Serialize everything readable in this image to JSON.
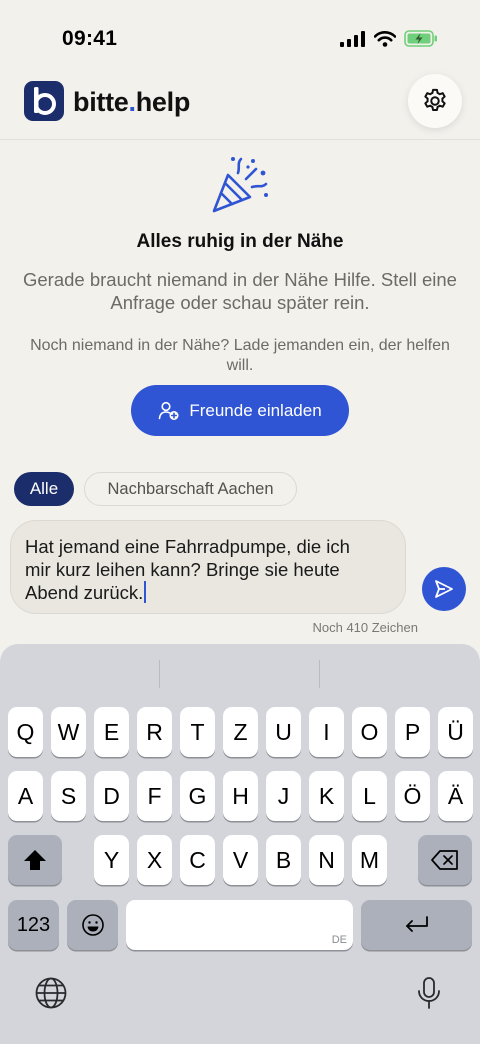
{
  "status": {
    "time": "09:41"
  },
  "header": {
    "brand_main": "bitte",
    "brand_dot": ".",
    "brand_suffix": "help",
    "logo_letter": "b"
  },
  "empty_state": {
    "title": "Alles ruhig in der Nähe",
    "description": "Gerade braucht niemand in der Nähe Hilfe. Stell eine Anfrage oder schau später rein.",
    "invite_hint": "Noch niemand in der Nähe? Lade jemanden ein, der helfen will.",
    "invite_button": "Freunde einladen"
  },
  "filters": {
    "all": "Alle",
    "neighborhood": "Nachbarschaft Aachen"
  },
  "composer": {
    "text": "Hat jemand eine Fahrradpumpe, die ich\nmir kurz leihen kann? Bringe sie heute\nAbend zurück.",
    "remaining": "Noch 410 Zeichen"
  },
  "keyboard": {
    "row1": [
      "Q",
      "W",
      "E",
      "R",
      "T",
      "Z",
      "U",
      "I",
      "O",
      "P",
      "Ü"
    ],
    "row2": [
      "A",
      "S",
      "D",
      "F",
      "G",
      "H",
      "J",
      "K",
      "L",
      "Ö",
      "Ä"
    ],
    "row3": [
      "Y",
      "X",
      "C",
      "V",
      "B",
      "N",
      "M"
    ],
    "numbers_key": "123",
    "space_lang": "DE"
  },
  "colors": {
    "accent": "#2F55D4",
    "brand_dark": "#1B2D6B",
    "background": "#F3F1EC"
  }
}
